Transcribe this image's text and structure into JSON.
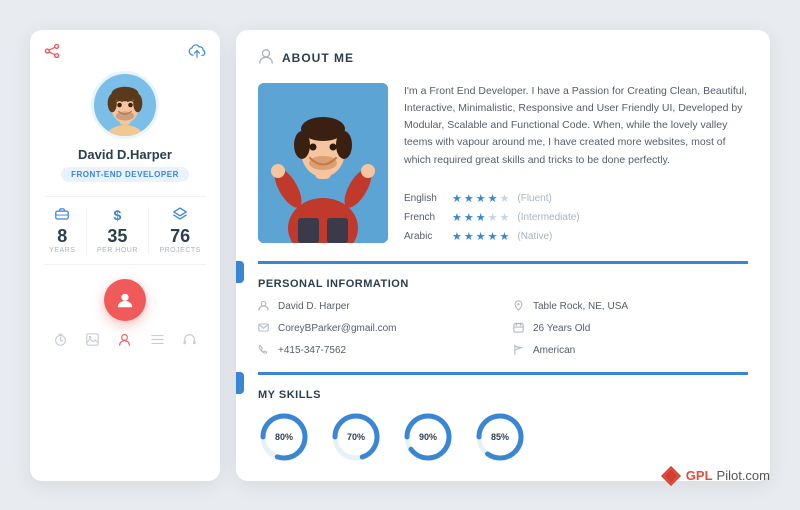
{
  "leftCard": {
    "name": "David D.Harper",
    "title": "Front-End Developer",
    "stats": [
      {
        "icon": "💼",
        "value": "8",
        "label": "Years"
      },
      {
        "icon": "$",
        "value": "35",
        "label": "Per Hour"
      },
      {
        "icon": "⧉",
        "value": "76",
        "label": "Projects"
      }
    ],
    "navIcons": [
      "⏱",
      "🖼",
      "👤",
      "≡",
      "🎧"
    ]
  },
  "rightCard": {
    "aboutMe": {
      "sectionTitle": "ABOUT ME",
      "description": "I'm a Front End Developer. I have a Passion for Creating Clean, Beautiful, Interactive, Minimalistic, Responsive and User Friendly UI, Developed by Modular, Scalable and Functional Code. When, while the lovely valley teems with vapour around me, I have created more websites, most of which required great skills and tricks to be done perfectly.",
      "languages": [
        {
          "name": "English",
          "stars": 4,
          "total": 5,
          "level": "(Fluent)"
        },
        {
          "name": "French",
          "stars": 3,
          "total": 5,
          "level": "(Intermediate)"
        },
        {
          "name": "Arabic",
          "stars": 5,
          "total": 5,
          "level": "(Native)"
        }
      ]
    },
    "personalInfo": {
      "sectionTitle": "PERSONAL INFORMATION",
      "items": [
        {
          "icon": "person",
          "text": "David D. Harper"
        },
        {
          "icon": "location",
          "text": "Table Rock, NE, USA"
        },
        {
          "icon": "email",
          "text": "CoreyBParker@gmail.com"
        },
        {
          "icon": "age",
          "text": "26 Years Old"
        },
        {
          "icon": "phone",
          "text": "+415-347-7562"
        },
        {
          "icon": "flag",
          "text": "American"
        }
      ]
    },
    "mySkills": {
      "sectionTitle": "MY SKILLS",
      "skills": [
        {
          "label": "",
          "pct": 80
        },
        {
          "label": "",
          "pct": 70
        },
        {
          "label": "",
          "pct": 90
        },
        {
          "label": "",
          "pct": 85
        }
      ]
    }
  },
  "watermark": {
    "bold": "GPL",
    "normal": "Pilot.com"
  }
}
